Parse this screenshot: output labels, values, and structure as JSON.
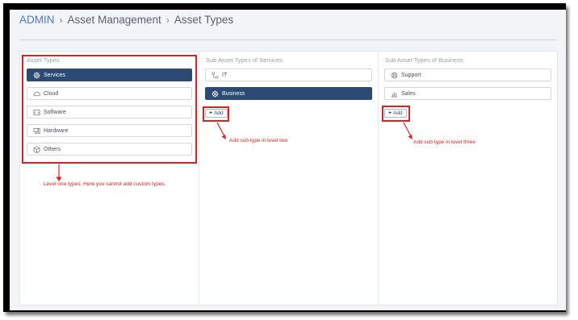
{
  "breadcrumb": {
    "root": "ADMIN",
    "level2": "Asset Management",
    "current": "Asset Types",
    "separator": "›"
  },
  "columns": {
    "asset_types": {
      "title": "Asset Types",
      "items": [
        {
          "label": "Services",
          "icon": "gear-icon",
          "selected": true
        },
        {
          "label": "Cloud",
          "icon": "cloud-icon",
          "selected": false
        },
        {
          "label": "Software",
          "icon": "software-icon",
          "selected": false
        },
        {
          "label": "Hardware",
          "icon": "hardware-icon",
          "selected": false
        },
        {
          "label": "Others",
          "icon": "box-icon",
          "selected": false
        }
      ]
    },
    "sub_services": {
      "title": "Sub Asset Types of Services",
      "items": [
        {
          "label": "IT",
          "icon": "network-icon",
          "selected": false
        },
        {
          "label": "Business",
          "icon": "gear-icon",
          "selected": true
        }
      ],
      "add_label": "Add"
    },
    "sub_business": {
      "title": "Sub Asset Types of Business",
      "items": [
        {
          "label": "Support",
          "icon": "lifebuoy-icon",
          "selected": false
        },
        {
          "label": "Sales",
          "icon": "chart-icon",
          "selected": false
        }
      ],
      "add_label": "Add"
    }
  },
  "annotations": {
    "level_one": "Level one types. Here you cannot add custom types.",
    "level_two": "Add sub-type in level two",
    "level_three": "Add sub-type in level three"
  },
  "colors": {
    "selected": "#2c4a73",
    "annotation": "#e02020",
    "link": "#4a7bd0"
  }
}
